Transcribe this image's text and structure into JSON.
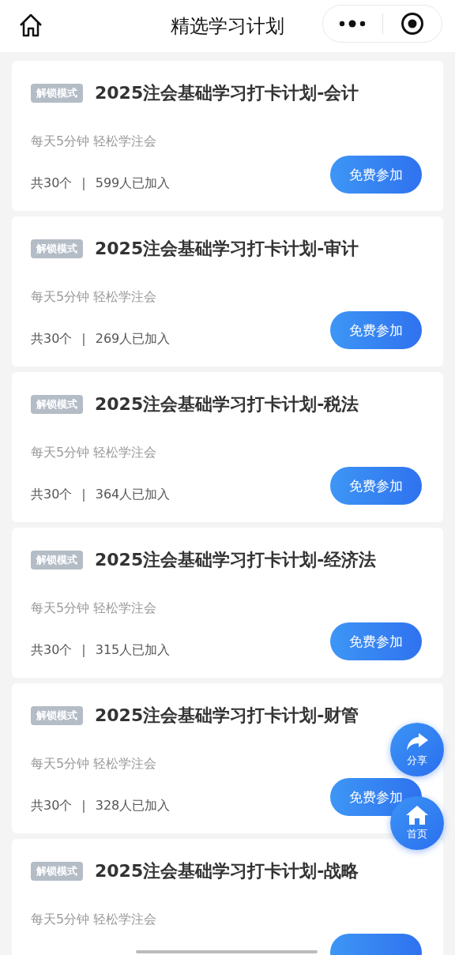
{
  "nav": {
    "title": "精选学习计划"
  },
  "cards": [
    {
      "tag": "解锁模式",
      "title": "2025注会基础学习打卡计划-会计",
      "subtitle": "每天5分钟 轻松学注会",
      "count": "共30个",
      "separator": "|",
      "joined": "599人已加入",
      "button": "免费参加"
    },
    {
      "tag": "解锁模式",
      "title": "2025注会基础学习打卡计划-审计",
      "subtitle": "每天5分钟 轻松学注会",
      "count": "共30个",
      "separator": "|",
      "joined": "269人已加入",
      "button": "免费参加"
    },
    {
      "tag": "解锁模式",
      "title": "2025注会基础学习打卡计划-税法",
      "subtitle": "每天5分钟 轻松学注会",
      "count": "共30个",
      "separator": "|",
      "joined": "364人已加入",
      "button": "免费参加"
    },
    {
      "tag": "解锁模式",
      "title": "2025注会基础学习打卡计划-经济法",
      "subtitle": "每天5分钟 轻松学注会",
      "count": "共30个",
      "separator": "|",
      "joined": "315人已加入",
      "button": "免费参加"
    },
    {
      "tag": "解锁模式",
      "title": "2025注会基础学习打卡计划-财管",
      "subtitle": "每天5分钟 轻松学注会",
      "count": "共30个",
      "separator": "|",
      "joined": "328人已加入",
      "button": "免费参加"
    },
    {
      "tag": "解锁模式",
      "title": "2025注会基础学习打卡计划-战略",
      "subtitle": "每天5分钟 轻松学注会"
    }
  ],
  "floating_buttons": [
    {
      "kind": "share",
      "label": "分享"
    },
    {
      "kind": "home",
      "label": "首页"
    }
  ]
}
